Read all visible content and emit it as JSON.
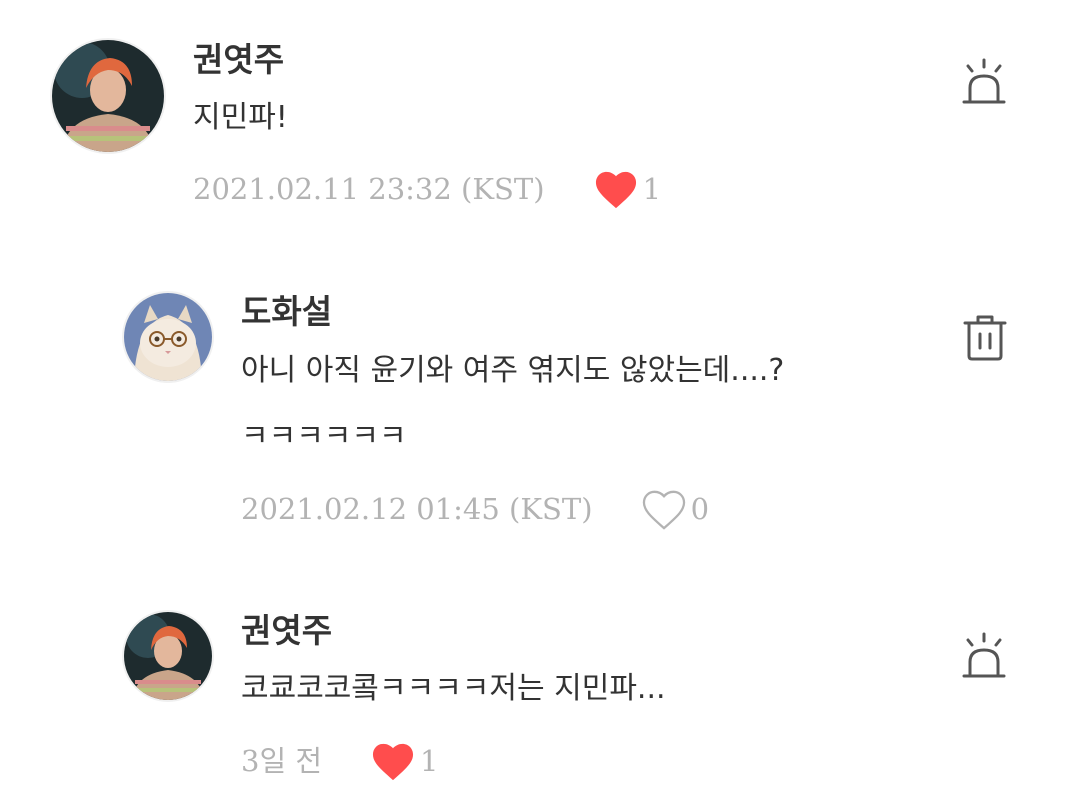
{
  "comments": [
    {
      "author": "권엿주",
      "lines": [
        "지민파!"
      ],
      "timestamp": "2021.02.11 23:32 (KST)",
      "liked": true,
      "like_count": "1",
      "action": "report",
      "avatar": "red-haired-person"
    },
    {
      "author": "도화설",
      "lines": [
        "아니 아직 윤기와 여주 엮지도 않았는데....?",
        "ㅋㅋㅋㅋㅋㅋ"
      ],
      "timestamp": "2021.02.12 01:45 (KST)",
      "liked": false,
      "like_count": "0",
      "action": "delete",
      "avatar": "cat-with-glasses"
    },
    {
      "author": "권엿주",
      "lines": [
        "코쿄코코콬ㅋㅋㅋㅋ저는 지민파..."
      ],
      "timestamp": "3일 전",
      "liked": true,
      "like_count": "1",
      "action": "report",
      "avatar": "red-haired-person"
    }
  ],
  "icons": {
    "report": "siren-icon",
    "delete": "trash-icon",
    "like_filled": "heart-filled-icon",
    "like_empty": "heart-outline-icon"
  },
  "colors": {
    "heart": "#ff4d4d",
    "muted_text": "#b3b3b3",
    "text": "#333333",
    "icon": "#555555"
  }
}
